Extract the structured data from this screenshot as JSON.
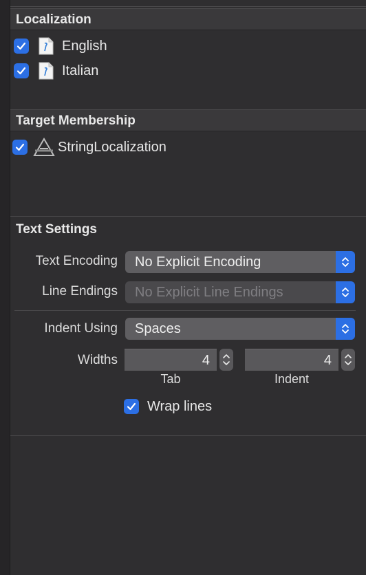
{
  "localization": {
    "title": "Localization",
    "items": [
      {
        "label": "English",
        "checked": true,
        "icon": "strings-file-icon"
      },
      {
        "label": "Italian",
        "checked": true,
        "icon": "strings-file-icon"
      }
    ]
  },
  "target_membership": {
    "title": "Target Membership",
    "items": [
      {
        "label": "StringLocalization",
        "checked": true,
        "icon": "app-target-icon"
      }
    ]
  },
  "text_settings": {
    "title": "Text Settings",
    "text_encoding_label": "Text Encoding",
    "text_encoding_value": "No Explicit Encoding",
    "line_endings_label": "Line Endings",
    "line_endings_value": "No Explicit Line Endings",
    "indent_using_label": "Indent Using",
    "indent_using_value": "Spaces",
    "widths_label": "Widths",
    "tab_value": "4",
    "tab_label": "Tab",
    "indent_value": "4",
    "indent_label": "Indent",
    "wrap_lines_label": "Wrap lines",
    "wrap_lines_checked": true
  },
  "colors": {
    "accent": "#2c6fe4",
    "background": "#2f2e30",
    "header": "#3a393b"
  }
}
